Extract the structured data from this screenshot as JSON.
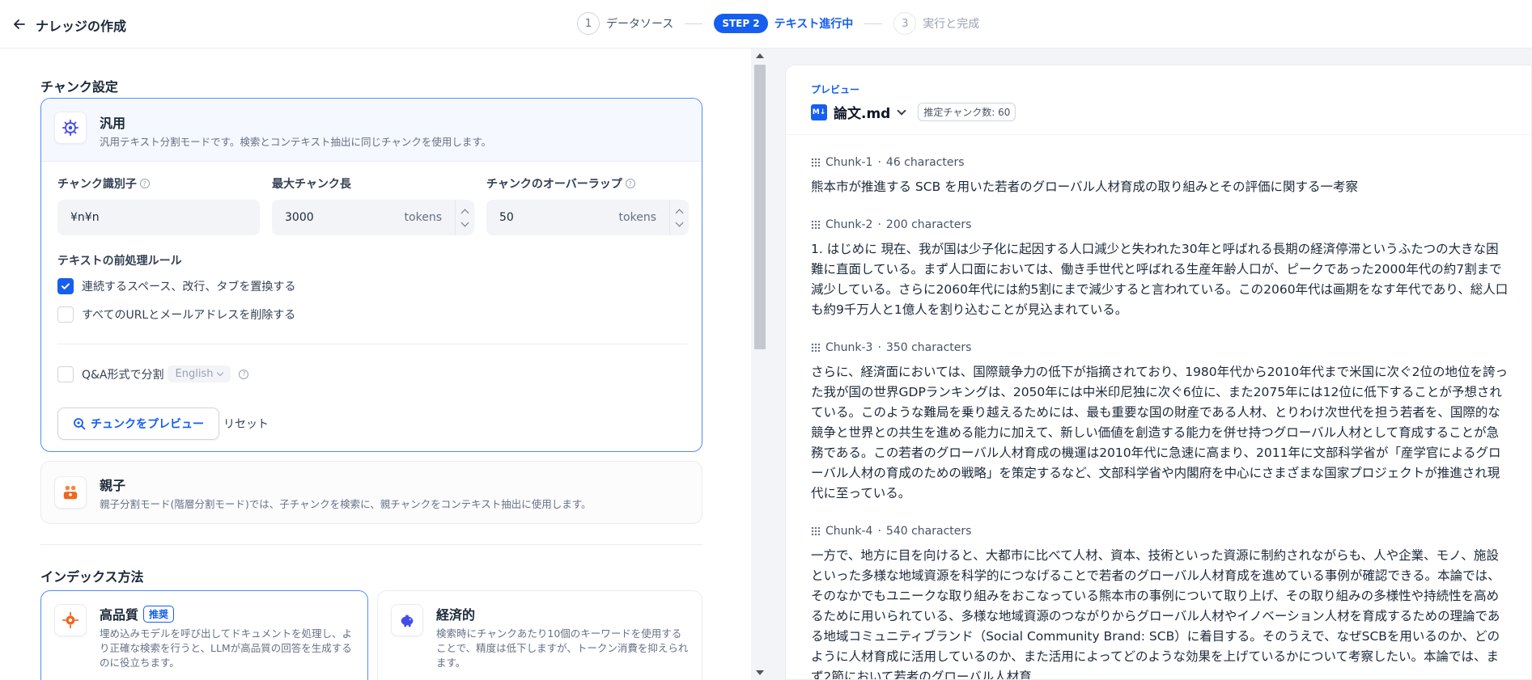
{
  "header": {
    "title": "ナレッジの作成",
    "steps": [
      {
        "num": "1",
        "label": "データソース"
      },
      {
        "pill": "STEP 2",
        "label": "テキスト進行中"
      },
      {
        "num": "3",
        "label": "実行と完成"
      }
    ]
  },
  "chunk_settings": {
    "section_title": "チャンク設定",
    "general": {
      "name": "汎用",
      "desc": "汎用テキスト分割モードです。検索とコンテキスト抽出に同じチャンクを使用します。",
      "delimiter_label": "チャンク識別子",
      "delimiter_value": "¥n¥n",
      "max_len_label": "最大チャンク長",
      "max_len_value": "3000",
      "overlap_label": "チャンクのオーバーラップ",
      "overlap_value": "50",
      "unit": "tokens",
      "preproc_title": "テキストの前処理ルール",
      "rule1": "連続するスペース、改行、タブを置換する",
      "rule1_checked": true,
      "rule2": "すべてのURLとメールアドレスを削除する",
      "rule2_checked": false,
      "qa_label": "Q&A形式で分割",
      "qa_lang": "English",
      "preview_button": "チュンクをプレビュー",
      "reset_button": "リセット"
    },
    "parent_child": {
      "name": "親子",
      "desc": "親子分割モード(階層分割モード)では、子チャンクを検索に、親チャンクをコンテキスト抽出に使用します。"
    }
  },
  "index_method": {
    "section_title": "インデックス方法",
    "high_quality": {
      "name": "高品質",
      "badge": "推奨",
      "desc": "埋め込みモデルを呼び出してドキュメントを処理し、より正確な検索を行うと、LLMが高品質の回答を生成するのに役立ちます。"
    },
    "economy": {
      "name": "経済的",
      "desc": "検索時にチャンクあたり10個のキーワードを使用することで、精度は低下しますが、トークン消費を抑えられます。"
    }
  },
  "preview": {
    "label": "プレビュー",
    "file_icon": "M↓",
    "file_name": "論文.md",
    "estimate": "推定チャンク数: 60",
    "chunks": [
      {
        "id": "Chunk-1",
        "chars": "46 characters",
        "text": "熊本市が推進する SCB を用いた若者のグローバル人材育成の取り組みとその評価に関する一考察"
      },
      {
        "id": "Chunk-2",
        "chars": "200 characters",
        "text": "1. はじめに 現在、我が国は少子化に起因する人口減少と失われた30年と呼ばれる長期の経済停滞というふたつの大きな困難に直面している。まず人口面においては、働き手世代と呼ばれる生産年齢人口が、ピークであった2000年代の約7割まで減少している。さらに2060年代には約5割にまで減少すると言われている。この2060年代は画期をなす年代であり、総人口も約9千万人と1億人を割り込むことが見込まれている。"
      },
      {
        "id": "Chunk-3",
        "chars": "350 characters",
        "text": "さらに、経済面においては、国際競争力の低下が指摘されており、1980年代から2010年代まで米国に次ぐ2位の地位を誇った我が国の世界GDPランキングは、2050年には中米印尼独に次ぐ6位に、また2075年には12位に低下することが予想されている。このような難局を乗り越えるためには、最も重要な国の財産である人材、とりわけ次世代を担う若者を、国際的な競争と世界との共生を進める能力に加えて、新しい価値を創造する能力を併せ持つグローバル人材として育成することが急務である。この若者のグローバル人材育成の機運は2010年代に急速に高まり、2011年に文部科学省が「産学官によるグローバル人材の育成のための戦略」を策定するなど、文部科学省や内閣府を中心にさまざまな国家プロジェクトが推進され現代に至っている。"
      },
      {
        "id": "Chunk-4",
        "chars": "540 characters",
        "text": "一方で、地方に目を向けると、大都市に比べて人材、資本、技術といった資源に制約されながらも、人や企業、モノ、施設といった多様な地域資源を科学的につなげることで若者のグローバル人材育成を進めている事例が確認できる。本論では、そのなかでもユニークな取り組みをおこなっている熊本市の事例について取り上げ、その取り組みの多様性や持続性を高めるために用いられている、多様な地域資源のつながりからグローバル人材やイノベーション人材を育成するための理論である地域コミュニティブランド（Social Community Brand: SCB）に着目する。そのうえで、なぜSCBを用いるのか、どのように人材育成に活用しているのか、また活用によってどのような効果を上げているかについて考察したい。本論では、まず2節において若者のグローバル人材育"
      }
    ]
  }
}
